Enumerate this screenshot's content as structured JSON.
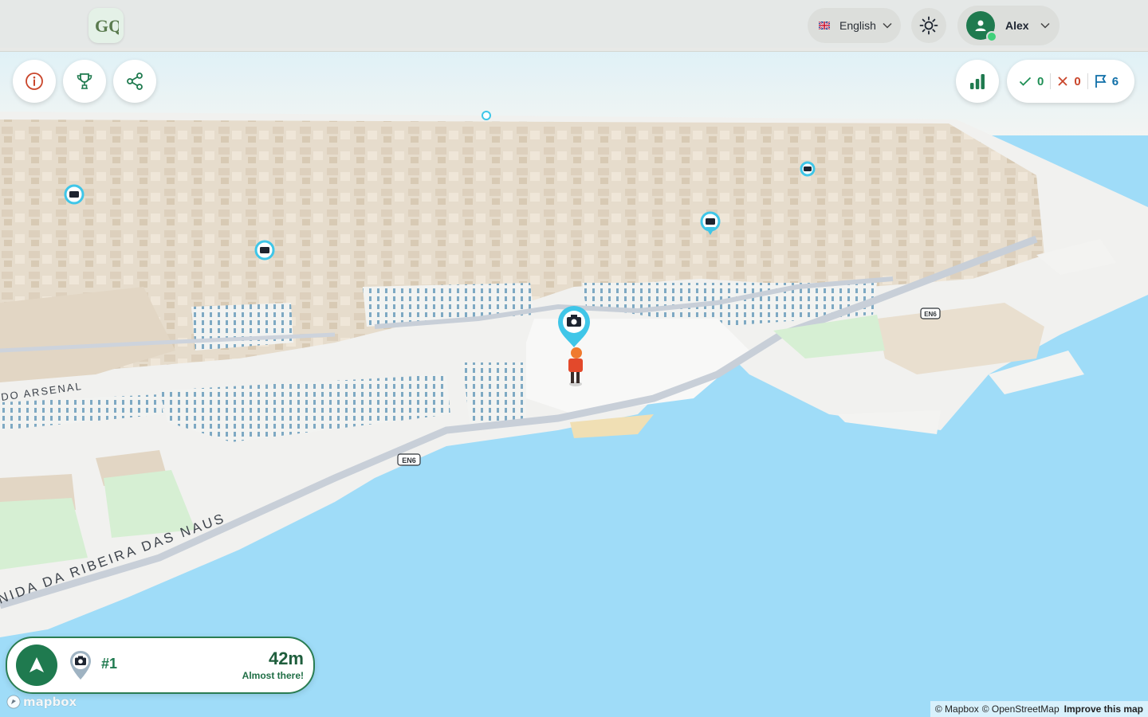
{
  "header": {
    "logo_text": "GQ",
    "language": {
      "flag_icon": "uk-flag-icon",
      "label": "English"
    },
    "theme_icon": "sun-icon",
    "user": {
      "name": "Alex",
      "status": "online"
    }
  },
  "actions": [
    {
      "name": "info-button",
      "icon": "info-icon"
    },
    {
      "name": "trophy-button",
      "icon": "trophy-icon"
    },
    {
      "name": "share-button",
      "icon": "share-icon"
    }
  ],
  "stats_icon": "bar-chart-icon",
  "score": {
    "correct": "0",
    "wrong": "0",
    "flags": "6"
  },
  "map": {
    "street_labels": [
      "DO ARSENAL",
      "NIDA DA RIBEIRA DAS NAUS"
    ],
    "road_shields": [
      "EN6",
      "EN6"
    ]
  },
  "navigation": {
    "target_number": "#1",
    "distance": "42m",
    "hint": "Almost there!"
  },
  "attribution": {
    "logo_text": "mapbox",
    "mapbox": "© Mapbox",
    "osm": "© OpenStreetMap",
    "improve": "Improve this map"
  },
  "colors": {
    "accent_green": "#1f7a4f",
    "correct_green": "#1f8f55",
    "wrong_red": "#c9452a",
    "flag_blue": "#0f6fa8",
    "water": "#9fdcf8",
    "marker_cyan": "#3fc6e8"
  }
}
